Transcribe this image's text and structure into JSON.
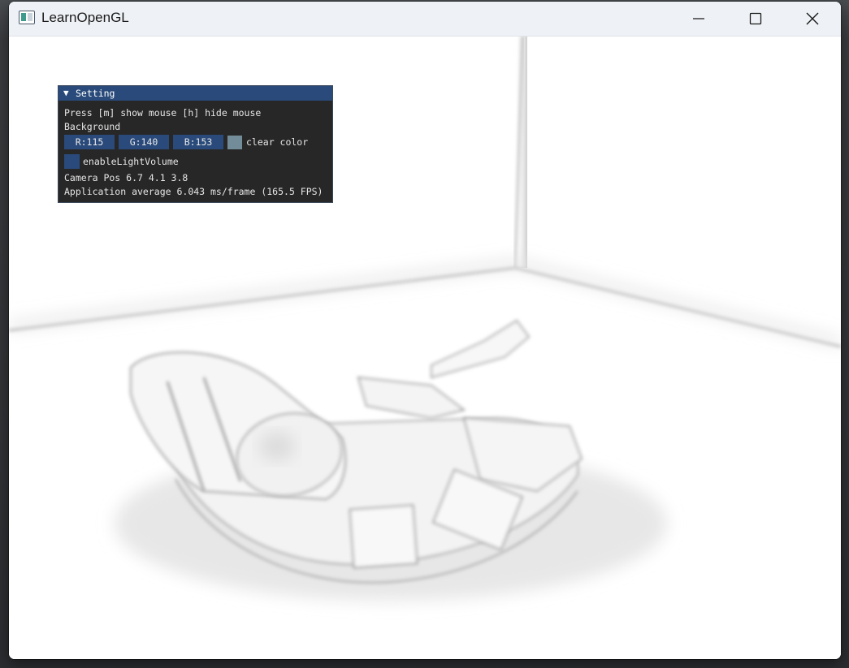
{
  "window": {
    "title": "LearnOpenGL",
    "controls": {
      "minimize_icon": "minimize-icon",
      "maximize_icon": "maximize-icon",
      "close_icon": "close-icon"
    }
  },
  "imgui": {
    "title": "Setting",
    "collapse_icon": "collapse-triangle-icon",
    "help_text": "Press [m] show mouse [h] hide mouse",
    "background_label": "Background",
    "color": {
      "r": "R:115",
      "g": "G:140",
      "b": "B:153",
      "swatch_hex": "#738c99",
      "label": "clear color"
    },
    "light_volume": {
      "label": "enableLightVolume",
      "checked": false
    },
    "camera_pos": "Camera Pos 6.7 4.1 3.8",
    "perf": "Application average 6.043 ms/frame (165.5 FPS)"
  },
  "colors": {
    "imgui_accent": "#294a7a",
    "imgui_bg": "#1e1e1e",
    "titlebar_bg": "#eef1f5",
    "clear_color": "#738c99"
  }
}
